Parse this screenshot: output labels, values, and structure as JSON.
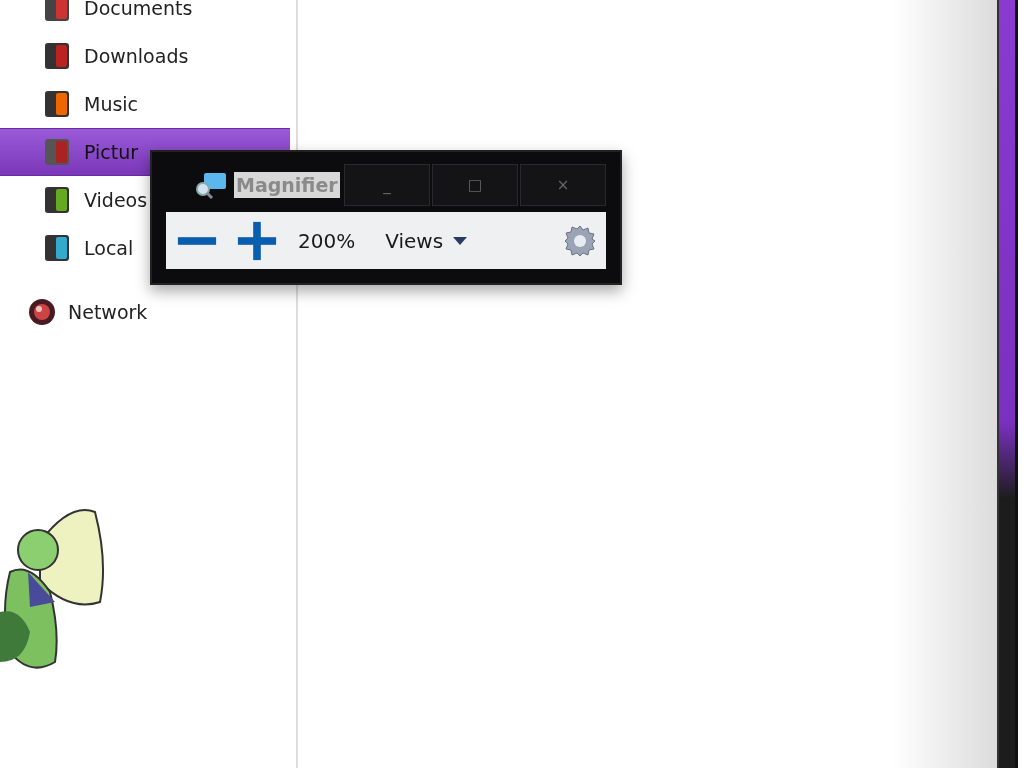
{
  "sidebar": {
    "items": [
      {
        "label": "Documents",
        "selected": false
      },
      {
        "label": "Downloads",
        "selected": false
      },
      {
        "label": "Music",
        "selected": false
      },
      {
        "label": "Pictur",
        "selected": true
      },
      {
        "label": "Videos",
        "selected": false
      },
      {
        "label": "Local",
        "selected": false
      }
    ],
    "network": {
      "label": "Network"
    }
  },
  "magnifier": {
    "title": "Magnifier",
    "window_buttons": [
      "_",
      "□",
      "×"
    ],
    "zoom_level": "200%",
    "views_menu": "Views"
  }
}
